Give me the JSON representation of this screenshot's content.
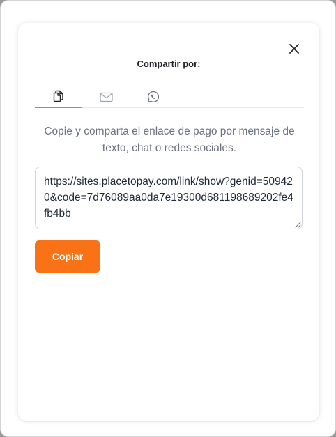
{
  "dialog": {
    "title": "Compartir por:",
    "close_icon": "close-icon"
  },
  "tabs": [
    {
      "id": "copy",
      "icon": "copy-icon",
      "active": true
    },
    {
      "id": "email",
      "icon": "mail-icon",
      "active": false
    },
    {
      "id": "whatsapp",
      "icon": "whatsapp-icon",
      "active": false
    }
  ],
  "content": {
    "description": "Copie y comparta el enlace de pago por mensaje de texto, chat o redes sociales.",
    "link": "https://sites.placetopay.com/link/show?genid=509420&code=7d76089aa0da7e19300d681198689202fe4fb4bb",
    "copy_button_label": "Copiar"
  },
  "colors": {
    "accent": "#f97316",
    "text_primary": "#1f2328",
    "text_muted": "#6b7280",
    "border": "#d1d5db"
  }
}
